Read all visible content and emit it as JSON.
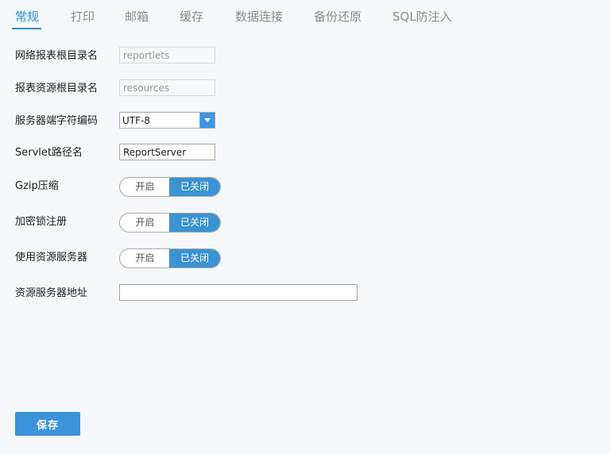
{
  "tabs": [
    {
      "label": "常规",
      "active": true
    },
    {
      "label": "打印"
    },
    {
      "label": "邮箱"
    },
    {
      "label": "缓存"
    },
    {
      "label": "数据连接"
    },
    {
      "label": "备份还原"
    },
    {
      "label": "SQL防注入"
    }
  ],
  "form": {
    "report_root": {
      "label": "网络报表根目录名",
      "value": "reportlets"
    },
    "resource_root": {
      "label": "报表资源根目录名",
      "value": "resources"
    },
    "encoding": {
      "label": "服务器端字符编码",
      "value": "UTF-8"
    },
    "servlet_path": {
      "label": "Servlet路径名",
      "value": "ReportServer"
    },
    "gzip": {
      "label": "Gzip压缩",
      "on_label": "开启",
      "off_label": "已关闭",
      "state": "off"
    },
    "dongle": {
      "label": "加密锁注册",
      "on_label": "开启",
      "off_label": "已关闭",
      "state": "off"
    },
    "resource_server": {
      "label": "使用资源服务器",
      "on_label": "开启",
      "off_label": "已关闭",
      "state": "off"
    },
    "resource_server_addr": {
      "label": "资源服务器地址",
      "value": ""
    }
  },
  "actions": {
    "save_label": "保存"
  },
  "colors": {
    "accent": "#2a8fdc",
    "toggle_off_bg": "#3b93d1",
    "background": "#f6f8fb"
  }
}
